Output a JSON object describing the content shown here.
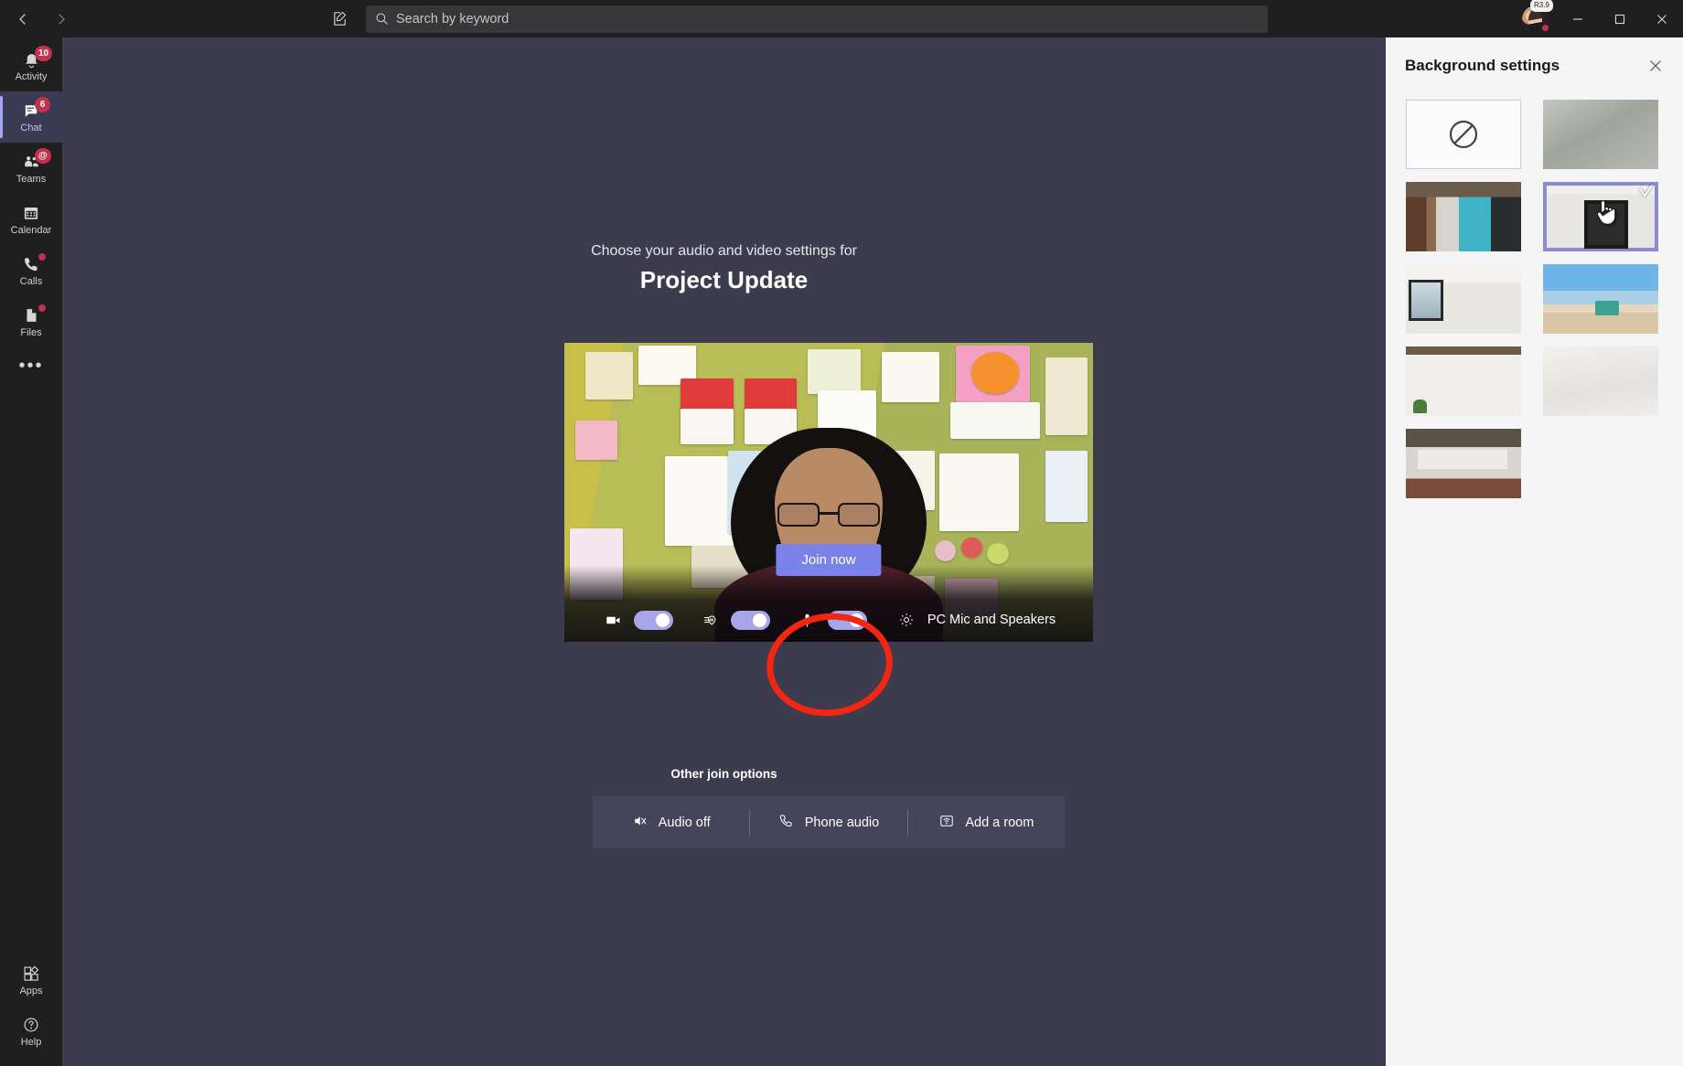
{
  "titlebar": {
    "back_tooltip": "Back",
    "forward_tooltip": "Forward",
    "compose_tooltip": "New conversation",
    "search_placeholder": "Search by keyword",
    "search_value": "",
    "avatar_bubble": "R3.9",
    "minimize_label": "—",
    "maximize_label": "❐",
    "close_label": "✕"
  },
  "rail": {
    "items": [
      {
        "label": "Activity",
        "icon": "bell-icon",
        "badge": "10",
        "dot": false,
        "active": false
      },
      {
        "label": "Chat",
        "icon": "chat-icon",
        "badge": "6",
        "dot": false,
        "active": true
      },
      {
        "label": "Teams",
        "icon": "teams-icon",
        "badge": "@",
        "dot": false,
        "active": false
      },
      {
        "label": "Calendar",
        "icon": "calendar-icon",
        "badge": "",
        "dot": false,
        "active": false
      },
      {
        "label": "Calls",
        "icon": "phone-icon",
        "badge": "",
        "dot": true,
        "active": false
      },
      {
        "label": "Files",
        "icon": "file-icon",
        "badge": "",
        "dot": true,
        "active": false
      }
    ],
    "more_label": "•••",
    "bottom_items": [
      {
        "label": "Apps",
        "icon": "apps-icon"
      },
      {
        "label": "Help",
        "icon": "help-icon"
      }
    ]
  },
  "prejoin": {
    "subtitle": "Choose your audio and video settings for",
    "meeting_title": "Project Update",
    "join_button": "Join now",
    "camera_toggle": {
      "name": "camera-toggle",
      "state": "on"
    },
    "background_toggle": {
      "name": "background-effects-toggle",
      "state": "on"
    },
    "mic_toggle": {
      "name": "microphone-toggle",
      "state": "on"
    },
    "device_label": "PC Mic and Speakers",
    "other_join_title": "Other join options",
    "other_join_options": [
      {
        "label": "Audio off",
        "icon": "speaker-muted-icon"
      },
      {
        "label": "Phone audio",
        "icon": "phone-icon"
      },
      {
        "label": "Add a room",
        "icon": "room-icon"
      }
    ]
  },
  "annotation": {
    "shape": "ellipse",
    "color": "#f22712",
    "target": "background-effects-toggle"
  },
  "panel": {
    "title": "Background settings",
    "close_label": "✕",
    "backgrounds": [
      {
        "name": "none",
        "label": "None",
        "selected": false,
        "art": "none"
      },
      {
        "name": "blur",
        "label": "Blur",
        "selected": false,
        "art": "t-blur-gray"
      },
      {
        "name": "office-lockers",
        "label": "Office lockers",
        "selected": false,
        "art": "t-office"
      },
      {
        "name": "room-mirror",
        "label": "Room with mirror",
        "selected": true,
        "art": "t-room-mirror"
      },
      {
        "name": "window-room",
        "label": "Room with window",
        "selected": false,
        "art": "t-window-room"
      },
      {
        "name": "beach",
        "label": "Beach",
        "selected": false,
        "art": "t-beach"
      },
      {
        "name": "plant-wall",
        "label": "Wall with plants",
        "selected": false,
        "art": "t-plant-wall"
      },
      {
        "name": "plain-wall",
        "label": "Plain wall",
        "selected": false,
        "art": "t-plain-wall"
      },
      {
        "name": "loft",
        "label": "Loft interior",
        "selected": false,
        "art": "t-loft"
      }
    ]
  },
  "colors": {
    "accent": "#7b83eb",
    "rail_bg": "#1f1f1f",
    "stage_bg": "#3d3c4e",
    "panel_bg": "#f5f5f5",
    "badge_red": "#c4314b",
    "annotation_red": "#f22712",
    "toggle_on": "#a6a6e8"
  }
}
